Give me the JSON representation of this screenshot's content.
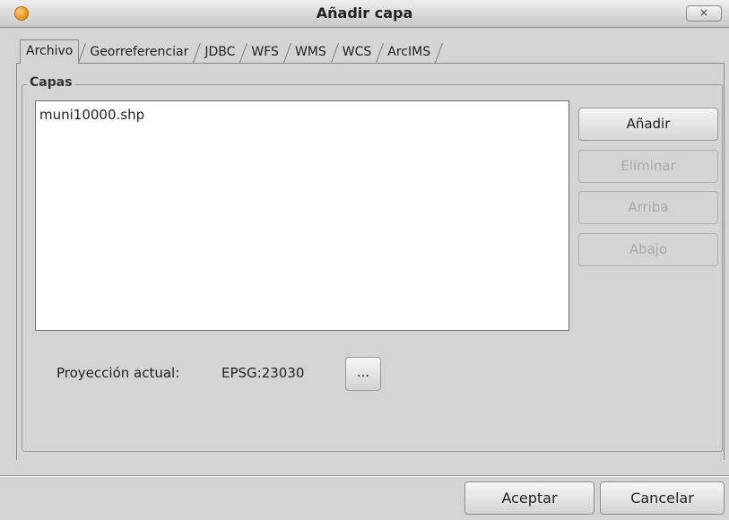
{
  "window": {
    "title": "Añadir capa",
    "close_label": "×"
  },
  "tabs": [
    {
      "label": "Archivo",
      "active": true
    },
    {
      "label": "Georreferenciar",
      "active": false
    },
    {
      "label": "JDBC",
      "active": false
    },
    {
      "label": "WFS",
      "active": false
    },
    {
      "label": "WMS",
      "active": false
    },
    {
      "label": "WCS",
      "active": false
    },
    {
      "label": "ArcIMS",
      "active": false
    }
  ],
  "layers_group": {
    "legend": "Capas",
    "items": [
      "muni10000.shp"
    ]
  },
  "side_buttons": {
    "add": "Añadir",
    "remove": "Eliminar",
    "up": "Arriba",
    "down": "Abajo"
  },
  "projection": {
    "label": "Proyección actual:",
    "value": "EPSG:23030",
    "button": "..."
  },
  "footer": {
    "accept": "Aceptar",
    "cancel": "Cancelar"
  },
  "colors": {
    "app_icon": "#f29a1e",
    "background": "#d4d4d4",
    "disabled_text": "#a9a9a9"
  }
}
